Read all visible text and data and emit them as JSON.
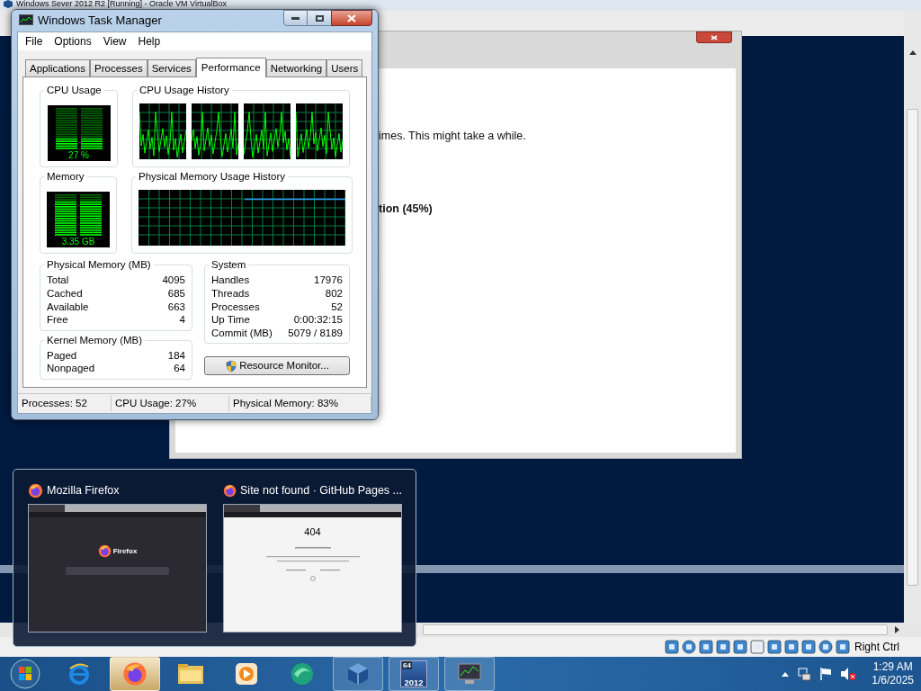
{
  "vbox_window": {
    "title": "Windows Sever 2012 R2 [Running] - Oracle VM VirtualBox",
    "host_key": "Right Ctrl"
  },
  "guest_dialog": {
    "lines": [
      {
        "text": "imes. This might take a while.",
        "bold": false
      },
      {
        "text": "tion (45%)",
        "bold": true
      }
    ]
  },
  "task_manager": {
    "title": "Windows Task Manager",
    "menu": [
      "File",
      "Options",
      "View",
      "Help"
    ],
    "tabs": [
      {
        "label": "Applications",
        "selected": false
      },
      {
        "label": "Processes",
        "selected": false
      },
      {
        "label": "Services",
        "selected": false
      },
      {
        "label": "Performance",
        "selected": true
      },
      {
        "label": "Networking",
        "selected": false
      },
      {
        "label": "Users",
        "selected": false
      }
    ],
    "cpu_usage": {
      "title": "CPU Usage",
      "reading": "27 %",
      "level": 0.27
    },
    "cpu_history": {
      "title": "CPU Usage History"
    },
    "memory": {
      "title": "Memory",
      "reading": "3.35 GB",
      "level": 0.83
    },
    "memory_history": {
      "title": "Physical Memory Usage History"
    },
    "physical_memory": {
      "title": "Physical Memory (MB)",
      "rows": [
        {
          "label": "Total",
          "value": "4095"
        },
        {
          "label": "Cached",
          "value": "685"
        },
        {
          "label": "Available",
          "value": "663"
        },
        {
          "label": "Free",
          "value": "4"
        }
      ]
    },
    "kernel_memory": {
      "title": "Kernel Memory (MB)",
      "rows": [
        {
          "label": "Paged",
          "value": "184"
        },
        {
          "label": "Nonpaged",
          "value": "64"
        }
      ]
    },
    "system": {
      "title": "System",
      "rows": [
        {
          "label": "Handles",
          "value": "17976"
        },
        {
          "label": "Threads",
          "value": "802"
        },
        {
          "label": "Processes",
          "value": "52"
        },
        {
          "label": "Up Time",
          "value": "0:00:32:15"
        },
        {
          "label": "Commit (MB)",
          "value": "5079 / 8189"
        }
      ]
    },
    "resource_monitor_button": "Resource Monitor...",
    "status_bar": [
      "Processes: 52",
      "CPU Usage: 27%",
      "Physical Memory: 83%"
    ]
  },
  "thumbnails": [
    {
      "title": "Mozilla Firefox",
      "kind": "start-page",
      "page_text": "Firefox"
    },
    {
      "title": "Site not found · GitHub Pages ...",
      "kind": "error-page",
      "page_text": "404"
    }
  ],
  "taskbar": {
    "buttons": [
      {
        "kind": "browser-e",
        "running": false,
        "selected": false
      },
      {
        "kind": "firefox",
        "running": true,
        "selected": true
      },
      {
        "kind": "folder",
        "running": false,
        "selected": false
      },
      {
        "kind": "media",
        "running": false,
        "selected": false
      },
      {
        "kind": "swirl",
        "running": false,
        "selected": false
      },
      {
        "kind": "cube",
        "running": true,
        "selected": false
      },
      {
        "kind": "server",
        "running": true,
        "selected": false,
        "labels": [
          "64",
          "2012"
        ]
      },
      {
        "kind": "monitor",
        "running": true,
        "selected": false
      }
    ],
    "time": "1:29 AM",
    "date": "1/6/2025"
  }
}
